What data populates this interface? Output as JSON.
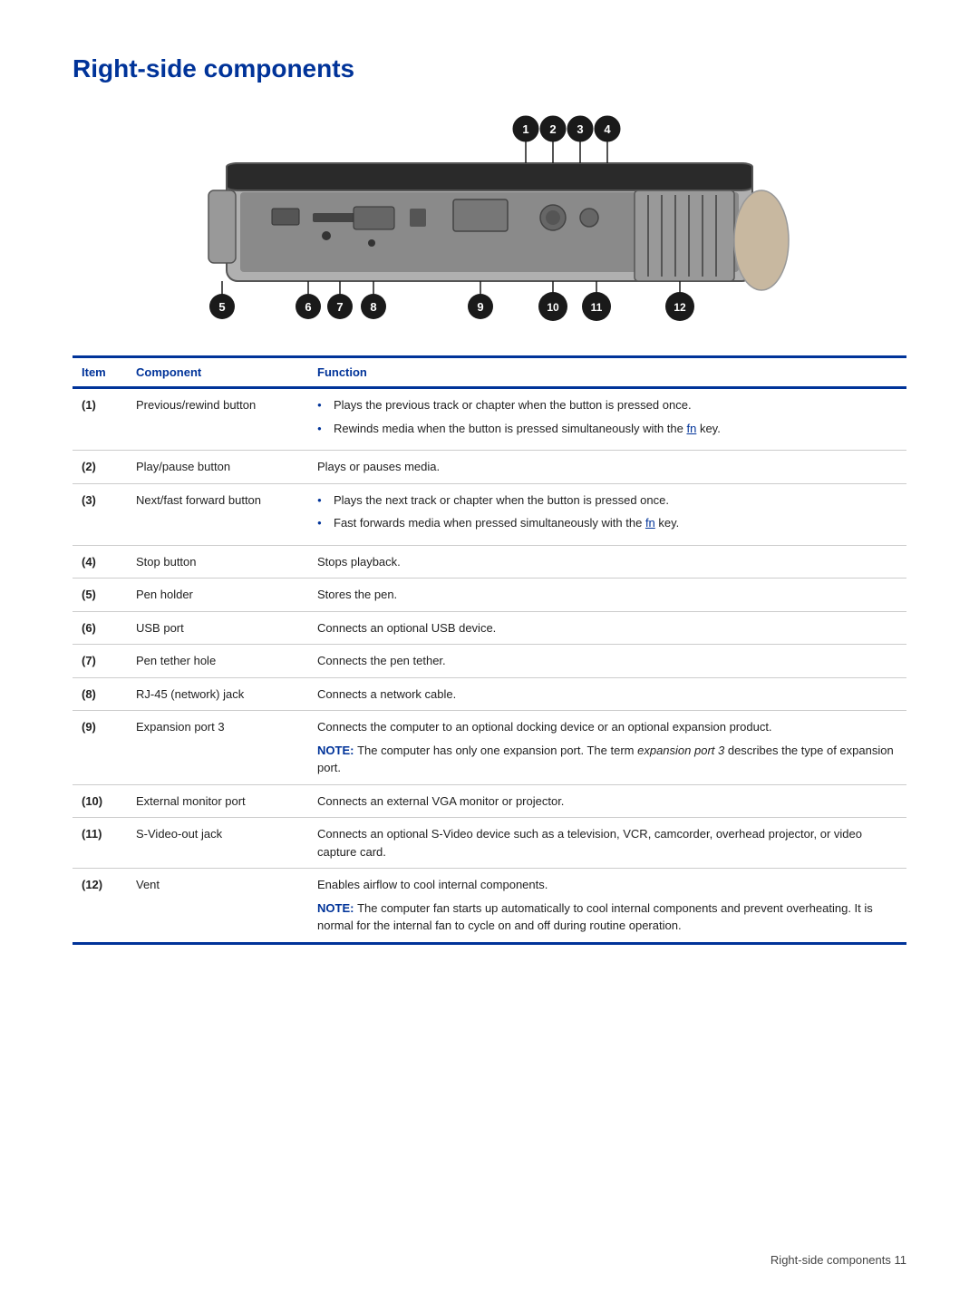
{
  "page": {
    "title": "Right-side components",
    "footer": "Right-side components  11"
  },
  "table": {
    "headers": {
      "item": "Item",
      "component": "Component",
      "function": "Function"
    },
    "rows": [
      {
        "item": "(1)",
        "component": "Previous/rewind button",
        "function_type": "bullets",
        "bullets": [
          "Plays the previous track or chapter when the button is pressed once.",
          "Rewinds media when the button is pressed simultaneously with the fn key."
        ]
      },
      {
        "item": "(2)",
        "component": "Play/pause button",
        "function_type": "plain",
        "plain": "Plays or pauses media."
      },
      {
        "item": "(3)",
        "component": "Next/fast forward button",
        "function_type": "bullets",
        "bullets": [
          "Plays the next track or chapter when the button is pressed once.",
          "Fast forwards media when pressed simultaneously with the fn key."
        ]
      },
      {
        "item": "(4)",
        "component": "Stop button",
        "function_type": "plain",
        "plain": "Stops playback."
      },
      {
        "item": "(5)",
        "component": "Pen holder",
        "function_type": "plain",
        "plain": "Stores the pen."
      },
      {
        "item": "(6)",
        "component": "USB port",
        "function_type": "plain",
        "plain": "Connects an optional USB device."
      },
      {
        "item": "(7)",
        "component": "Pen tether hole",
        "function_type": "plain",
        "plain": "Connects the pen tether."
      },
      {
        "item": "(8)",
        "component": "RJ-45 (network) jack",
        "function_type": "plain",
        "plain": "Connects a network cable."
      },
      {
        "item": "(9)",
        "component": "Expansion port 3",
        "function_type": "mixed",
        "plain": "Connects the computer to an optional docking device or an optional expansion product.",
        "note": "The computer has only one expansion port. The term expansion port 3 describes the type of expansion port.",
        "note_italic": "expansion port 3"
      },
      {
        "item": "(10)",
        "component": "External monitor port",
        "function_type": "plain",
        "plain": "Connects an external VGA monitor or projector."
      },
      {
        "item": "(11)",
        "component": "S-Video-out jack",
        "function_type": "plain",
        "plain": "Connects an optional S-Video device such as a television, VCR, camcorder, overhead projector, or video capture card."
      },
      {
        "item": "(12)",
        "component": "Vent",
        "function_type": "mixed",
        "plain": "Enables airflow to cool internal components.",
        "note": "The computer fan starts up automatically to cool internal components and prevent overheating. It is normal for the internal fan to cycle on and off during routine operation."
      }
    ]
  },
  "diagram": {
    "callouts_top": [
      "1",
      "2",
      "3",
      "4"
    ],
    "callouts_bottom": [
      "5",
      "6",
      "7",
      "8",
      "9",
      "10",
      "11",
      "12"
    ]
  }
}
